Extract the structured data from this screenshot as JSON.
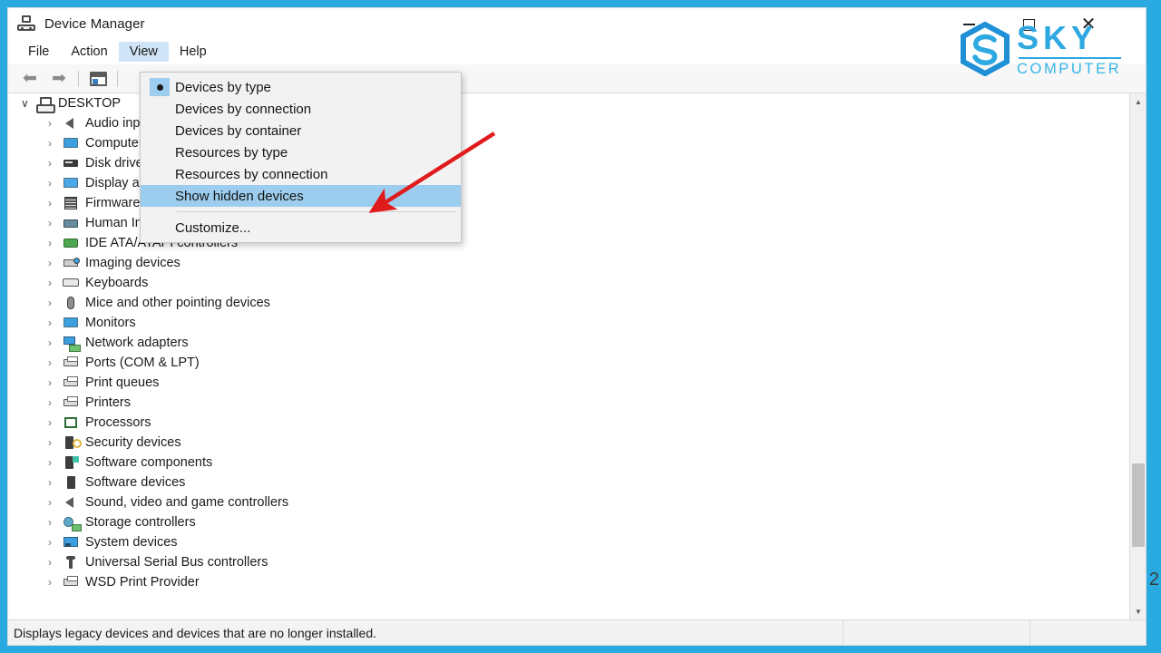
{
  "window": {
    "title": "Device Manager",
    "app_icon": "device-manager-icon",
    "controls": {
      "minimize": "minimize-icon",
      "maximize": "maximize-icon",
      "close": "close-icon"
    }
  },
  "menubar": {
    "items": [
      {
        "label": "File",
        "active": false
      },
      {
        "label": "Action",
        "active": false
      },
      {
        "label": "View",
        "active": true
      },
      {
        "label": "Help",
        "active": false
      }
    ]
  },
  "toolbar": {
    "back": "back-arrow-icon",
    "forward": "forward-arrow-icon",
    "properties": "properties-icon"
  },
  "view_menu": {
    "items": [
      {
        "label": "Devices by type",
        "checked": true,
        "highlighted": false
      },
      {
        "label": "Devices by connection",
        "checked": false,
        "highlighted": false
      },
      {
        "label": "Devices by container",
        "checked": false,
        "highlighted": false
      },
      {
        "label": "Resources by type",
        "checked": false,
        "highlighted": false
      },
      {
        "label": "Resources by connection",
        "checked": false,
        "highlighted": false
      },
      {
        "label": "Show hidden devices",
        "checked": false,
        "highlighted": true
      },
      {
        "label": "Customize...",
        "checked": false,
        "highlighted": false
      }
    ],
    "separator_after_index": 5
  },
  "tree": {
    "root": {
      "label": "DESKTOP",
      "expanded": true,
      "icon": "computer-root-icon"
    },
    "items": [
      {
        "label": "Audio inputs and outputs",
        "icon": "speaker-icon"
      },
      {
        "label": "Computer",
        "icon": "monitor-icon"
      },
      {
        "label": "Disk drives",
        "icon": "disk-icon"
      },
      {
        "label": "Display adapters",
        "icon": "display-adapter-icon"
      },
      {
        "label": "Firmware",
        "icon": "firmware-icon"
      },
      {
        "label": "Human Interface Devices",
        "icon": "hid-icon"
      },
      {
        "label": "IDE ATA/ATAPI controllers",
        "icon": "ide-controller-icon"
      },
      {
        "label": "Imaging devices",
        "icon": "imaging-icon"
      },
      {
        "label": "Keyboards",
        "icon": "keyboard-icon"
      },
      {
        "label": "Mice and other pointing devices",
        "icon": "mouse-icon"
      },
      {
        "label": "Monitors",
        "icon": "monitor-icon"
      },
      {
        "label": "Network adapters",
        "icon": "network-adapter-icon"
      },
      {
        "label": "Ports (COM & LPT)",
        "icon": "port-icon"
      },
      {
        "label": "Print queues",
        "icon": "printer-icon"
      },
      {
        "label": "Printers",
        "icon": "printer-icon"
      },
      {
        "label": "Processors",
        "icon": "processor-icon"
      },
      {
        "label": "Security devices",
        "icon": "security-device-icon"
      },
      {
        "label": "Software components",
        "icon": "software-component-icon"
      },
      {
        "label": "Software devices",
        "icon": "software-device-icon"
      },
      {
        "label": "Sound, video and game controllers",
        "icon": "speaker-icon"
      },
      {
        "label": "Storage controllers",
        "icon": "storage-controller-icon"
      },
      {
        "label": "System devices",
        "icon": "system-device-icon"
      },
      {
        "label": "Universal Serial Bus controllers",
        "icon": "usb-icon"
      },
      {
        "label": "WSD Print Provider",
        "icon": "printer-icon"
      }
    ],
    "collapsed_chevron": "›",
    "expanded_chevron": "∨"
  },
  "scrollbar": {
    "up_arrow": "▲",
    "down_arrow": "▼"
  },
  "statusbar": {
    "message": "Displays legacy devices and devices that are no longer installed."
  },
  "watermark": {
    "brand": "SKY",
    "subtitle": "COMPUTER",
    "color": "#2ea8e0"
  },
  "annotation": {
    "arrow": "red-pointer-arrow",
    "color": "#e01b1b"
  },
  "edge_digit": "2",
  "colors": {
    "frame_blue": "#29ABE2",
    "menu_highlight": "#9ccdee",
    "menubar_active": "#cfe4f7"
  }
}
